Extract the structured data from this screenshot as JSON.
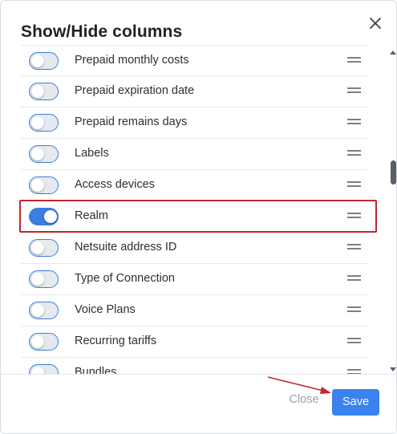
{
  "dialog": {
    "title": "Show/Hide columns"
  },
  "columns": [
    {
      "label": "Prepaid monthly costs",
      "enabled": false
    },
    {
      "label": "Prepaid expiration date",
      "enabled": false
    },
    {
      "label": "Prepaid remains days",
      "enabled": false
    },
    {
      "label": "Labels",
      "enabled": false
    },
    {
      "label": "Access devices",
      "enabled": false
    },
    {
      "label": "Realm",
      "enabled": true
    },
    {
      "label": "Netsuite address ID",
      "enabled": false
    },
    {
      "label": "Type of Connection",
      "enabled": false
    },
    {
      "label": "Voice Plans",
      "enabled": false
    },
    {
      "label": "Recurring tariffs",
      "enabled": false
    },
    {
      "label": "Bundles",
      "enabled": false
    }
  ],
  "footer": {
    "close_label": "Close",
    "save_label": "Save"
  },
  "colors": {
    "accent": "#3a82ee",
    "highlight": "#c0272d"
  },
  "icons": {
    "close": "close-icon",
    "drag": "drag-handle-icon"
  }
}
